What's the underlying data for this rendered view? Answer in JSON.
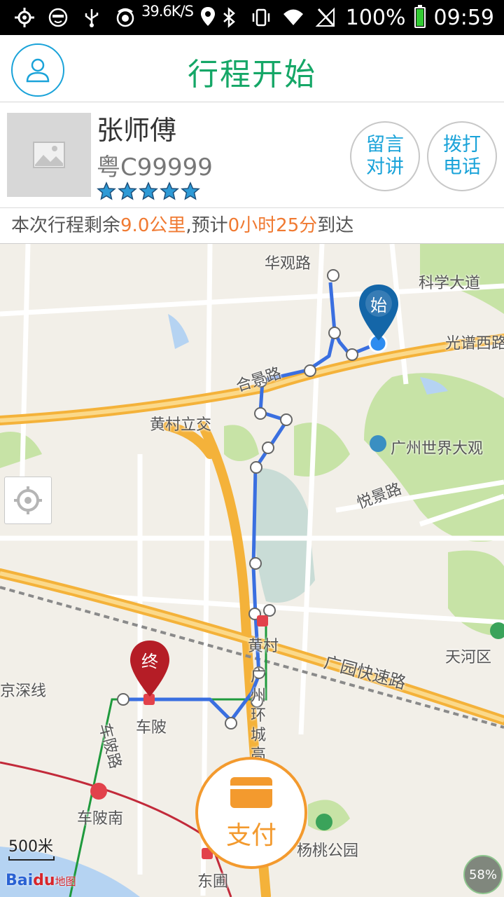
{
  "status_bar": {
    "net_speed": "39.6K/S",
    "battery_percent": "100%",
    "time": "09:59",
    "icons": [
      "gps-icon",
      "emoji-icon",
      "usb-icon",
      "app-icon",
      "location-icon",
      "bluetooth-icon",
      "vibrate-icon",
      "wifi-icon",
      "signal-icon",
      "battery-icon"
    ]
  },
  "header": {
    "title": "行程开始"
  },
  "driver": {
    "name": "张师傅",
    "plate": "粤C99999",
    "rating": 5,
    "message_button": "留言\n对讲",
    "message_line1": "留言",
    "message_line2": "对讲",
    "call_line1": "拨打",
    "call_line2": "电话"
  },
  "trip": {
    "prefix": "本次行程剩余",
    "distance": "9.0公里",
    "mid": ",预计",
    "eta": "0小时25分",
    "suffix": "到达"
  },
  "map": {
    "labels": {
      "huaguan": "华观路",
      "kexue": "科学大道",
      "guangpu": "光谱西路",
      "hejing": "合景路",
      "huangcun_interchange": "黄村立交",
      "world_park": "广州世界大观",
      "yuejing": "悦景路",
      "huangcun": "黄村",
      "guangyuan": "广园快速路",
      "jingshen": "京深线",
      "chebei": "车陂",
      "chebei_road": "车陂路",
      "huancheng": "广州环城高",
      "tianhe": "天河区",
      "chebei_south": "车陂南",
      "yangtao_park": "杨桃公园",
      "dongpu": "东圃"
    },
    "start_marker": "始",
    "end_marker": "终",
    "scale": "500米",
    "logo_bai": "Bai",
    "logo_du": "du",
    "logo_suffix": "地图",
    "zoom_badge": "58%",
    "colors": {
      "route": "#3a6fe0",
      "highway": "#f4b23a",
      "green": "#c7e3a6",
      "water": "#b5d3f2"
    }
  },
  "pay": {
    "label": "支付"
  }
}
